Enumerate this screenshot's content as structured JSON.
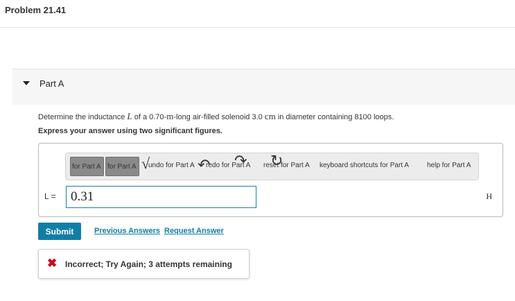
{
  "header": {
    "title": "Problem 21.41"
  },
  "part": {
    "label": "Part A",
    "expanded_icon": "caret-down-icon"
  },
  "question": {
    "pre": "Determine the inductance ",
    "var": "L",
    "mid": " of a 0.70-",
    "unit_m": "m",
    "mid2": "-long air-filled solenoid 3.0 ",
    "unit_cm": "cm",
    "post": " in diameter containing 8100 loops."
  },
  "instruction": "Express your answer using two significant figures.",
  "toolbar": {
    "btn1_alt": "for Part A",
    "btn2_alt": "for Part A",
    "undo": "undo for Part A",
    "redo": "redo for Part A",
    "reset": "reset for Part A",
    "shortcuts": "keyboard shortcuts for Part A",
    "help": "help for Part A",
    "glyph_sqrt": "√",
    "glyph_undo": "↶",
    "glyph_redo": "↷",
    "glyph_reset": "↻",
    "glyph_help": "?"
  },
  "answer": {
    "var_label": "L =",
    "value": "0.31",
    "unit": "H"
  },
  "actions": {
    "submit": "Submit",
    "previous": "Previous Answers",
    "request": "Request Answer"
  },
  "feedback": {
    "icon": "✖",
    "text": "Incorrect; Try Again; 3 attempts remaining",
    "color": "#d0021b"
  },
  "colors": {
    "accent": "#117ea7",
    "input_border": "#1e7fa3"
  }
}
